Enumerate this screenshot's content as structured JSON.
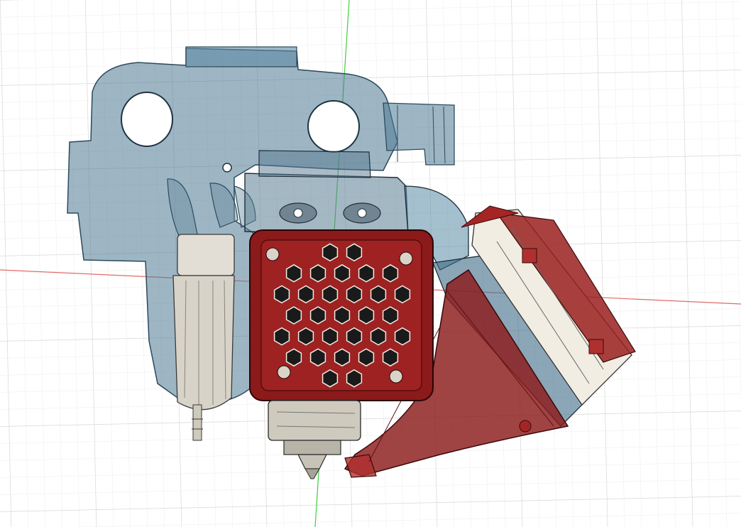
{
  "app": {
    "view": "3d-model-viewport",
    "background": "#ffffff"
  },
  "scene": {
    "grid": {
      "visible": true,
      "minor_color": "#e8e8e8",
      "major_color": "#d6d6d6"
    },
    "axes": {
      "x_axis_color": "#e05555",
      "y_axis_color": "#33cc33"
    },
    "model": {
      "parts": [
        {
          "name": "mount-plate",
          "color": "#3d6a85",
          "style": "translucent"
        },
        {
          "name": "fan-shroud-front",
          "color": "#8b1a1a",
          "style": "solid"
        },
        {
          "name": "radial-fan",
          "color": "#f0ece2",
          "style": "solid"
        },
        {
          "name": "fan-duct",
          "color": "#8b1a1a",
          "style": "translucent"
        },
        {
          "name": "bowden-fitting",
          "color": "#dcd8ce",
          "style": "solid"
        },
        {
          "name": "hotend",
          "color": "#c9c4b8",
          "style": "solid"
        }
      ]
    }
  }
}
